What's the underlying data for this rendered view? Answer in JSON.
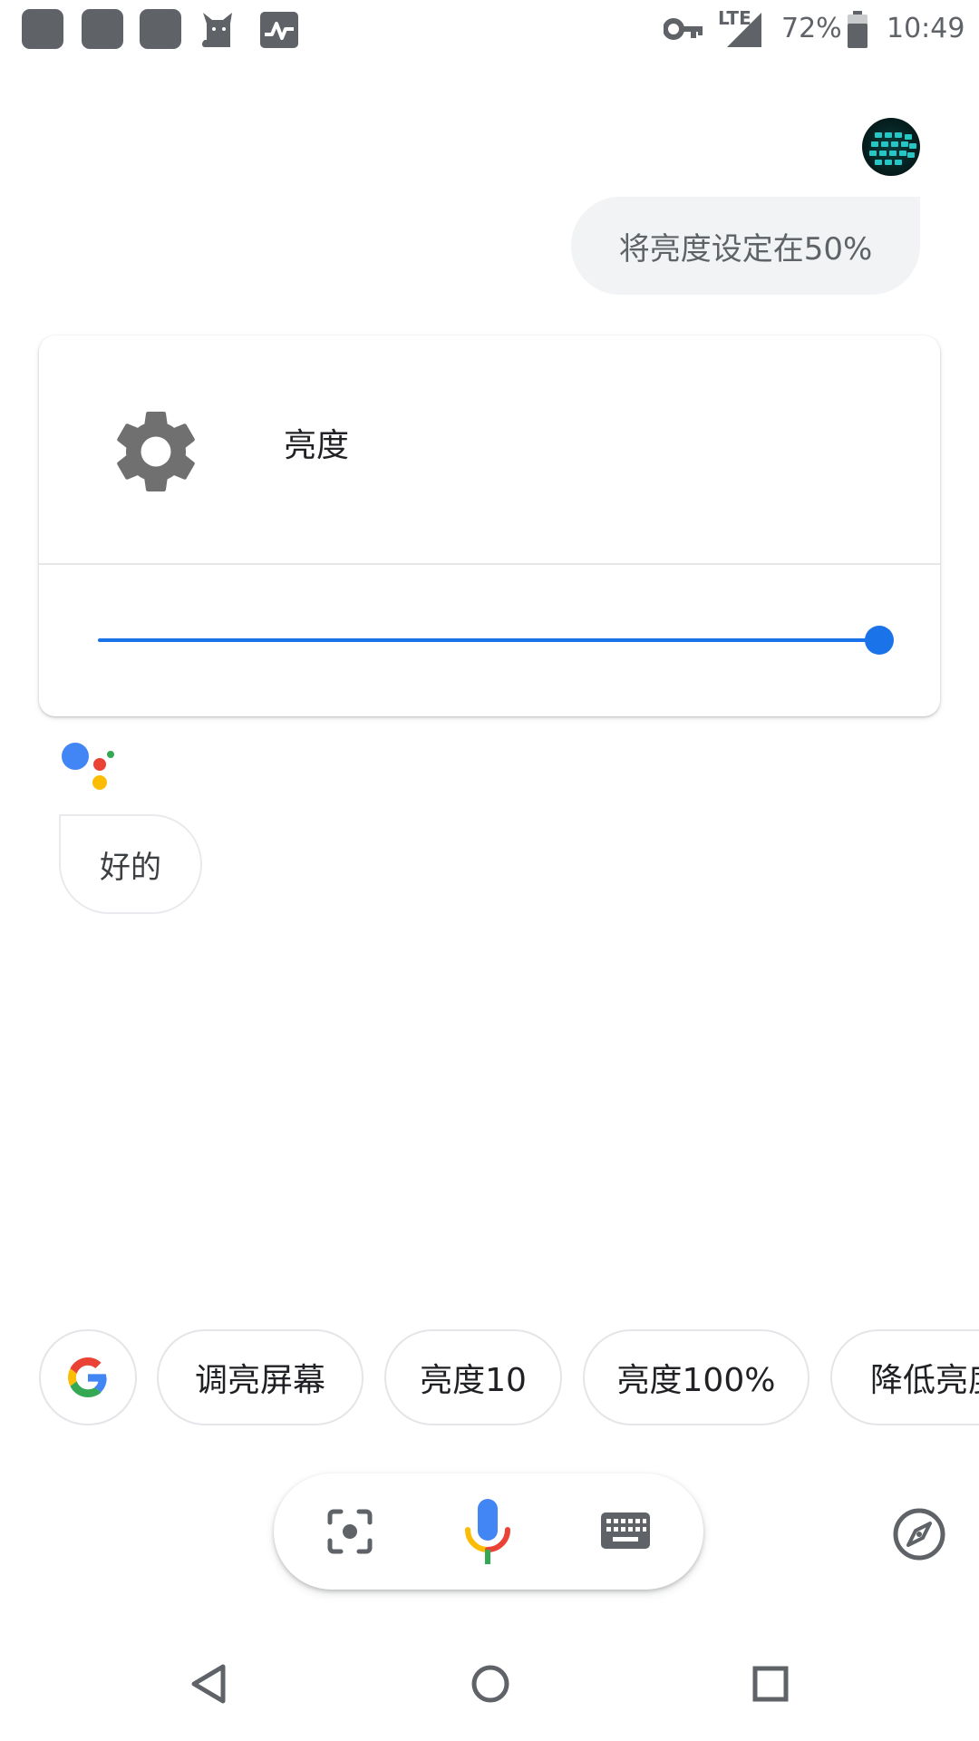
{
  "status_bar": {
    "notification_icons": [
      "notification-square-icon",
      "notification-square-icon",
      "notification-square-icon",
      "cat-icon",
      "activity-graph-icon"
    ],
    "vpn_icon": "key-icon",
    "network_label": "LTE",
    "battery_percent": "72%",
    "battery_level": 0.72,
    "time": "10:49"
  },
  "conversation": {
    "user_query": "将亮度设定在50%",
    "assistant_reply": "好的"
  },
  "settings_card": {
    "icon": "gear-icon",
    "title": "亮度",
    "slider_value_fraction": 1.0
  },
  "suggestions": {
    "google_chip_icon": "google-g-icon",
    "chips": [
      "调亮屏幕",
      "亮度10",
      "亮度100%",
      "降低亮度"
    ]
  },
  "input_bar": {
    "left_icon": "lens-icon",
    "center_icon": "microphone-icon",
    "right_icon": "keyboard-icon",
    "explore_icon": "compass-icon"
  },
  "nav_bar": {
    "buttons": [
      "back-icon",
      "home-icon",
      "recents-icon"
    ]
  },
  "colors": {
    "accent": "#1a73e8",
    "google_blue": "#4285f4",
    "google_red": "#ea4335",
    "google_yellow": "#fbbc04",
    "google_green": "#34a853",
    "icon_grey": "#5f6368"
  }
}
